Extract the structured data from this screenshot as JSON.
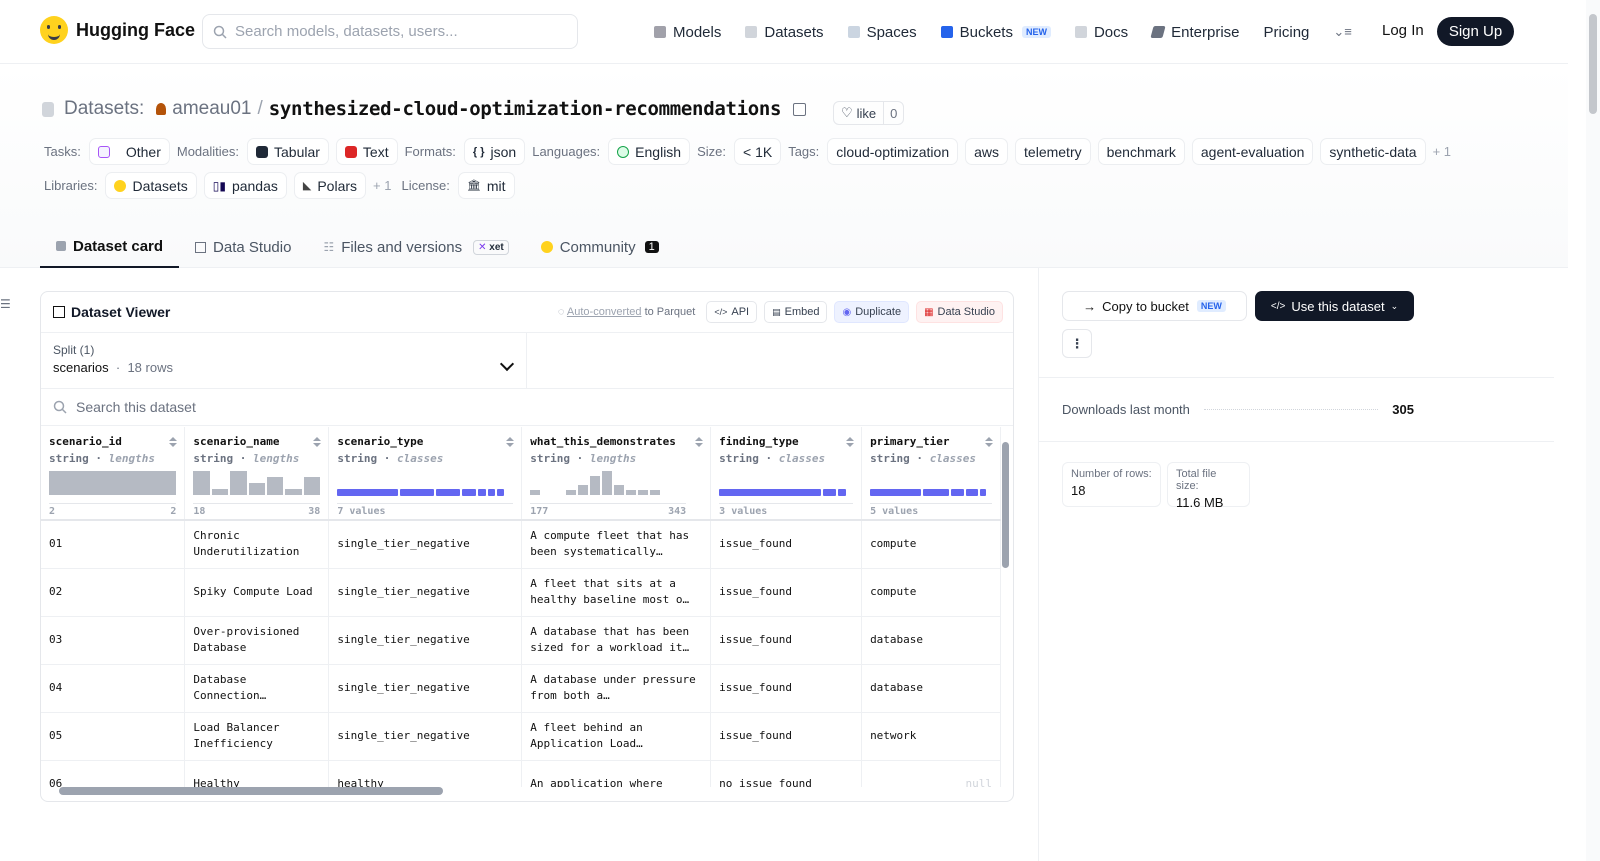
{
  "nav": {
    "brand": "Hugging Face",
    "search_placeholder": "Search models, datasets, users...",
    "links": [
      "Models",
      "Datasets",
      "Spaces",
      "Buckets",
      "Docs",
      "Enterprise",
      "Pricing"
    ],
    "new_badge": "NEW",
    "login": "Log In",
    "signup": "Sign Up"
  },
  "header": {
    "section_label": "Datasets:",
    "owner": "ameau01",
    "separator": "/",
    "dataset_name": "synthesized-cloud-optimization-recommendations",
    "like_label": "like",
    "like_count": "0",
    "tasks_label": "Tasks:",
    "task": "Other",
    "modalities_label": "Modalities:",
    "modalities": [
      "Tabular",
      "Text"
    ],
    "formats_label": "Formats:",
    "format": "json",
    "languages_label": "Languages:",
    "language": "English",
    "size_label": "Size:",
    "size": "< 1K",
    "tags_label": "Tags:",
    "tags": [
      "cloud-optimization",
      "aws",
      "telemetry",
      "benchmark",
      "agent-evaluation",
      "synthetic-data"
    ],
    "tags_more": "+ 1",
    "libraries_label": "Libraries:",
    "libraries": [
      "Datasets",
      "pandas",
      "Polars"
    ],
    "libraries_more": "+ 1",
    "license_label": "License:",
    "license": "mit"
  },
  "tabs": {
    "card": "Dataset card",
    "studio": "Data Studio",
    "files": "Files and versions",
    "xet": "xet",
    "community": "Community",
    "community_count": "1"
  },
  "viewer": {
    "title": "Dataset Viewer",
    "auto_converted": "Auto-converted",
    "to_parquet": "to Parquet",
    "api": "API",
    "embed": "Embed",
    "duplicate": "Duplicate",
    "data_studio": "Data Studio",
    "split_label": "Split (1)",
    "split_name": "scenarios",
    "split_rows": "18 rows",
    "search_placeholder": "Search this dataset",
    "columns": [
      {
        "name": "scenario_id",
        "type": "string",
        "stat": "lengths",
        "range_min": "2",
        "range_max": "2"
      },
      {
        "name": "scenario_name",
        "type": "string",
        "stat": "lengths",
        "range_min": "18",
        "range_max": "38"
      },
      {
        "name": "scenario_type",
        "type": "string",
        "stat": "classes",
        "values": "7 values"
      },
      {
        "name": "what_this_demonstrates",
        "type": "string",
        "stat": "lengths",
        "range_min": "177",
        "range_max": "343"
      },
      {
        "name": "finding_type",
        "type": "string",
        "stat": "classes",
        "values": "3 values"
      },
      {
        "name": "primary_tier",
        "type": "string",
        "stat": "classes",
        "values": "5 values"
      }
    ],
    "rows": [
      [
        "01",
        "Chronic Underutilization",
        "single_tier_negative",
        "A compute fleet that has been systematically…",
        "issue_found",
        "compute"
      ],
      [
        "02",
        "Spiky Compute Load",
        "single_tier_negative",
        "A fleet that sits at a healthy baseline most o…",
        "issue_found",
        "compute"
      ],
      [
        "03",
        "Over-provisioned Database",
        "single_tier_negative",
        "A database that has been sized for a workload it…",
        "issue_found",
        "database"
      ],
      [
        "04",
        "Database Connection…",
        "single_tier_negative",
        "A database under pressure from both a…",
        "issue_found",
        "database"
      ],
      [
        "05",
        "Load Balancer Inefficiency",
        "single_tier_negative",
        "A fleet behind an Application Load…",
        "issue_found",
        "network"
      ],
      [
        "06",
        "Healthy",
        "healthy",
        "An application where",
        "no_issue_found",
        "null"
      ]
    ]
  },
  "sidebar": {
    "copy_to_bucket": "Copy to bucket",
    "new_badge": "NEW",
    "use_dataset": "Use this dataset",
    "more": "⋮",
    "downloads_label": "Downloads last month",
    "downloads": "305",
    "rows_label": "Number of rows:",
    "rows_value": "18",
    "filesize_label": "Total file size:",
    "filesize_value": "11.6 MB"
  },
  "chart_data": {
    "type": "bar",
    "title": "",
    "series": [
      {
        "values": [
          1
        ]
      },
      {
        "values": [
          4,
          1,
          4,
          2,
          3,
          1,
          3
        ]
      },
      {
        "values": [
          1,
          0,
          0,
          1,
          2,
          4,
          5,
          2,
          1,
          1,
          1
        ]
      }
    ]
  }
}
